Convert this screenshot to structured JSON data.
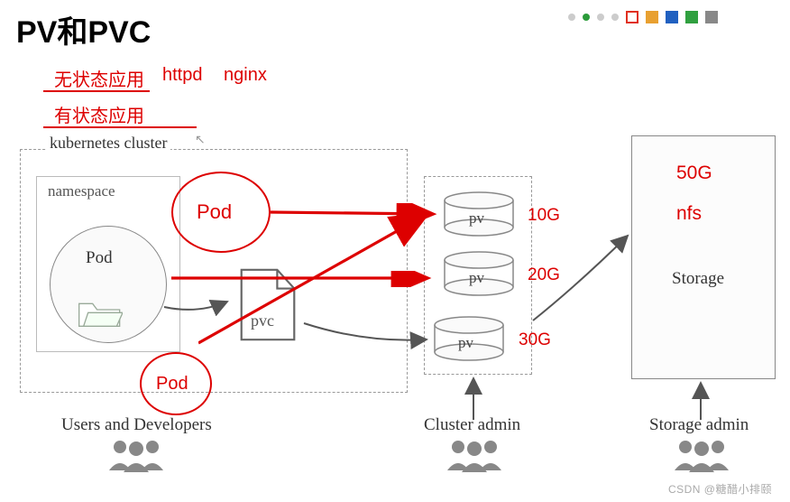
{
  "title": "PV和PVC",
  "nav_colors": {
    "active": "#2b9b3a",
    "red_outline": "#e03020",
    "gold": "#e8a030",
    "blue": "#2060c0",
    "green": "#30a040",
    "gray": "#888888"
  },
  "annotations": {
    "stateless": "无状态应用",
    "httpd": "httpd",
    "nginx": "nginx",
    "stateful": "有状态应用"
  },
  "cluster_label": "kubernetes cluster",
  "namespace_label": "namespace",
  "pod_label": "Pod",
  "pvc_label": "pvc",
  "circles": {
    "c1_label": "Pod",
    "c2_label": "Pod"
  },
  "pvs": [
    {
      "label": "pv",
      "size": "10G"
    },
    {
      "label": "pv",
      "size": "20G"
    },
    {
      "label": "pv",
      "size": "30G"
    }
  ],
  "storage": {
    "total": "50G",
    "type": "nfs",
    "label": "Storage"
  },
  "roles": {
    "users": "Users and Developers",
    "cluster_admin": "Cluster admin",
    "storage_admin": "Storage admin"
  },
  "watermark": "CSDN @糖醋小排颐"
}
